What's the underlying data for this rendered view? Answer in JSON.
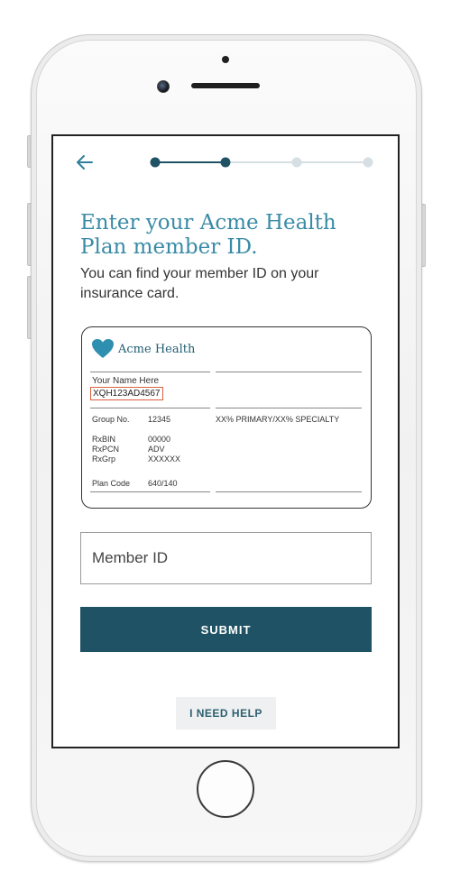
{
  "nav": {
    "back_icon": "arrow-left-icon"
  },
  "progress": {
    "total_steps": 4,
    "current_step": 2,
    "active_color": "#1f5264",
    "inactive_color": "#d6dfe3"
  },
  "header": {
    "title": "Enter your Acme Health Plan member ID.",
    "subtitle": "You can find your member ID on your insurance card."
  },
  "card": {
    "brand": "Acme Health",
    "brand_icon": "heart-icon",
    "brand_color": "#3a8ba6",
    "name_label": "Your Name Here",
    "member_id": "XQH123AD4567",
    "group_label": "Group No.",
    "group_value": "12345",
    "coverage": "XX% PRIMARY/XX% SPECIALTY",
    "rx_labels": [
      "RxBIN",
      "RxPCN",
      "RxGrp"
    ],
    "rx_values": [
      "00000",
      "ADV",
      "XXXXXX"
    ],
    "plan_label": "Plan Code",
    "plan_value": "640/140"
  },
  "form": {
    "member_id_placeholder": "Member ID",
    "submit_label": "SUBMIT",
    "help_label": "I NEED HELP"
  }
}
